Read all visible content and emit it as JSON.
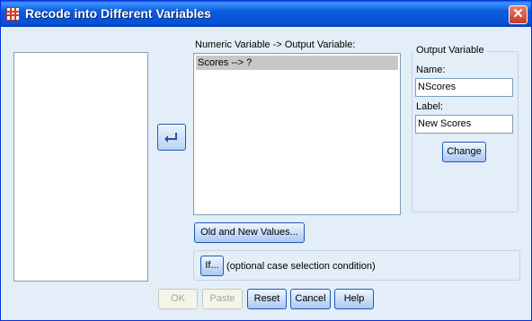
{
  "window": {
    "title": "Recode into Different Variables",
    "close_glyph": "✕"
  },
  "mapping": {
    "label": "Numeric Variable -> Output Variable:",
    "items": [
      "Scores --> ?"
    ]
  },
  "output_group": {
    "legend": "Output Variable",
    "name_label": "Name:",
    "name_value": "NScores",
    "label_label": "Label:",
    "label_value": "New Scores",
    "change_button": "Change"
  },
  "old_new_button": "Old and New Values...",
  "condition": {
    "if_button": "If...",
    "text": "(optional case selection condition)"
  },
  "buttons": {
    "ok": "OK",
    "paste": "Paste",
    "reset": "Reset",
    "cancel": "Cancel",
    "help": "Help"
  },
  "icons": {
    "move": "right-arrow-icon",
    "app": "spss-grid-icon"
  }
}
